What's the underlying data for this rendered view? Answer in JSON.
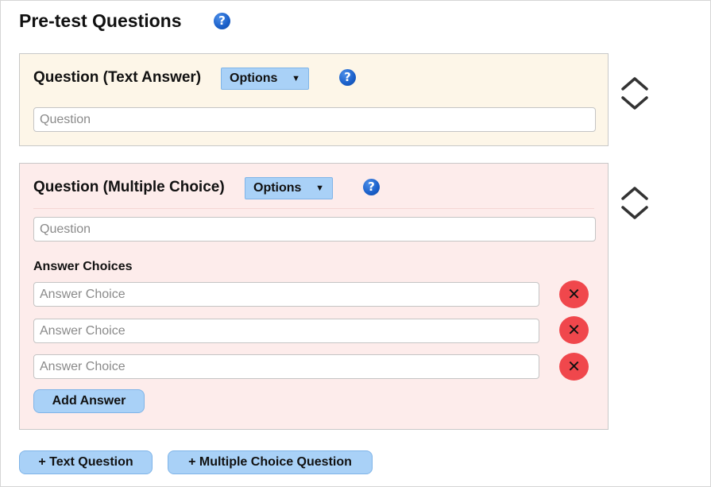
{
  "page": {
    "title": "Pre-test Questions",
    "help_glyph": "?"
  },
  "text_question": {
    "title": "Question (Text Answer)",
    "options_label": "Options",
    "caret": "▼",
    "question_placeholder": "Question"
  },
  "mc_question": {
    "title": "Question (Multiple Choice)",
    "options_label": "Options",
    "caret": "▼",
    "question_placeholder": "Question",
    "answers_label": "Answer Choices",
    "answer_choices": [
      {
        "placeholder": "Answer Choice",
        "remove_glyph": "✕"
      },
      {
        "placeholder": "Answer Choice",
        "remove_glyph": "✕"
      },
      {
        "placeholder": "Answer Choice",
        "remove_glyph": "✕"
      }
    ],
    "add_answer_label": "Add Answer"
  },
  "footer": {
    "add_text_question_label": "+ Text Question",
    "add_mc_question_label": "+ Multiple Choice Question"
  },
  "icons": {
    "help": "help-icon",
    "move_up": "chevron-up-icon",
    "move_down": "chevron-down-icon",
    "remove": "close-icon"
  },
  "colors": {
    "text_panel_bg": "#fdf6e8",
    "mc_panel_bg": "#fdeceb",
    "button_blue": "#a9d1f7",
    "remove_red": "#f0474c",
    "help_blue": "#1a5fc9"
  }
}
